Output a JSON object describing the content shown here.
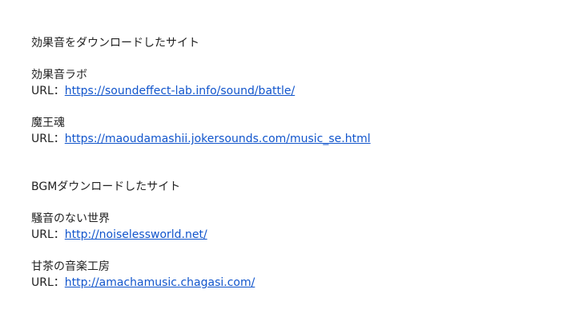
{
  "sections": [
    {
      "heading": "効果音をダウンロードしたサイト",
      "sites": [
        {
          "name": "効果音ラボ",
          "url_label": "URL：",
          "url": "https://soundeffect-lab.info/sound/battle/"
        },
        {
          "name": "魔王魂",
          "url_label": "URL：",
          "url": "https://maoudamashii.jokersounds.com/music_se.html"
        }
      ]
    },
    {
      "heading": "BGMダウンロードしたサイト",
      "sites": [
        {
          "name": "騒音のない世界",
          "url_label": "URL：",
          "url": "http://noiselessworld.net/"
        },
        {
          "name": "甘茶の音楽工房",
          "url_label": "URL：",
          "url": "http://amachamusic.chagasi.com/"
        }
      ]
    }
  ],
  "colors": {
    "text": "#222222",
    "link": "#1155cc",
    "background": "#ffffff"
  }
}
